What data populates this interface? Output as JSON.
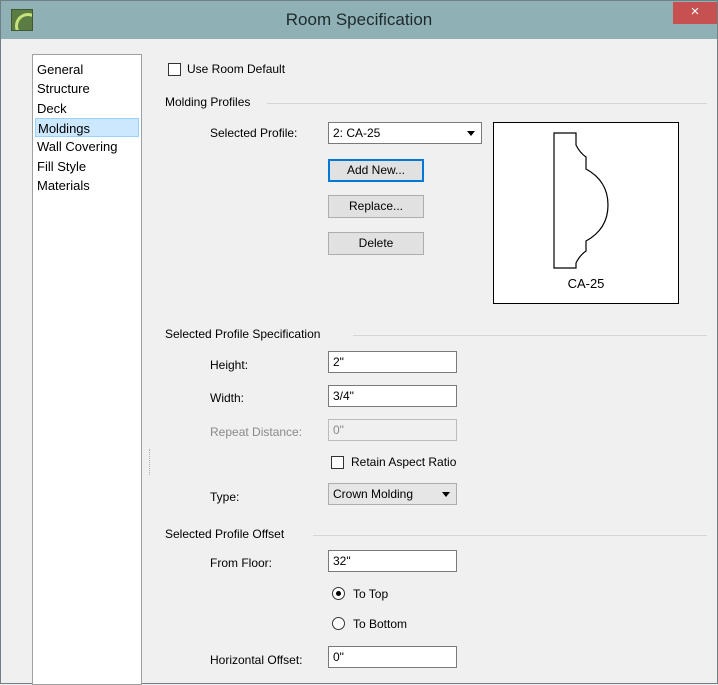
{
  "window": {
    "title": "Room Specification",
    "close_glyph": "×"
  },
  "sidebar": {
    "items": [
      "General",
      "Structure",
      "Deck",
      "Moldings",
      "Wall Covering",
      "Fill Style",
      "Materials"
    ],
    "selected": "Moldings"
  },
  "use_room_default": {
    "label": "Use Room Default",
    "checked": false
  },
  "molding_profiles": {
    "group_label": "Molding Profiles",
    "selected_profile_label": "Selected Profile:",
    "selected_profile_value": "2:  CA-25",
    "add_new": "Add New...",
    "replace": "Replace...",
    "delete": "Delete",
    "preview_caption": "CA-25"
  },
  "spec": {
    "group_label": "Selected Profile Specification",
    "height_label": "Height:",
    "height_value": "2\"",
    "width_label": "Width:",
    "width_value": "3/4\"",
    "repeat_label": "Repeat Distance:",
    "repeat_value": "0\"",
    "retain_label": "Retain Aspect Ratio",
    "retain_checked": false,
    "type_label": "Type:",
    "type_value": "Crown Molding"
  },
  "offset": {
    "group_label": "Selected Profile Offset",
    "from_floor_label": "From Floor:",
    "from_floor_value": "32\"",
    "to_top_label": "To Top",
    "to_bottom_label": "To Bottom",
    "selected": "To Top",
    "horizontal_label": "Horizontal Offset:",
    "horizontal_value": "0\""
  },
  "colors": {
    "titlebar": "#8fb1b6",
    "close": "#c75050",
    "selection": "#cce8ff"
  },
  "icons": [
    "app-logo-icon",
    "close-icon",
    "dropdown-arrow-icon",
    "molding-profile-icon"
  ]
}
